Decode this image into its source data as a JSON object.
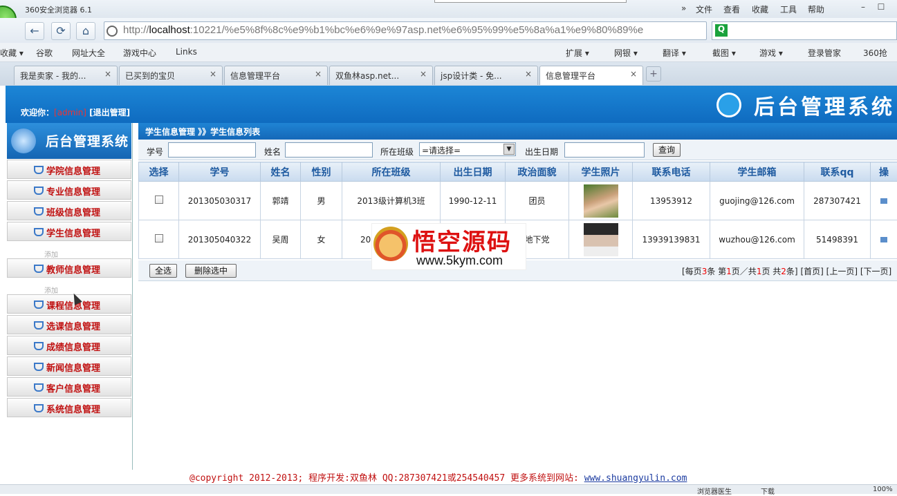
{
  "window": {
    "title": "360安全浏览器 6.1",
    "menu": [
      "文件",
      "查看",
      "收藏",
      "工具",
      "帮助"
    ],
    "min": "–",
    "max": "☐",
    "nav_chevron": "»"
  },
  "nav": {
    "back": "←",
    "refresh": "⟳",
    "home": "⌂",
    "url_prefix": "http://",
    "url_host": "localhost",
    "url_rest": ":10221/%e5%8f%8c%e9%b1%bc%e6%9e%97asp.net%e6%95%99%e5%8a%a1%e9%80%89%e",
    "search_icon": "Q"
  },
  "bookmarks": {
    "left": [
      "收藏 ▾",
      "谷歌",
      "网址大全",
      "游戏中心",
      "Links"
    ],
    "right": [
      "扩展 ▾",
      "网银 ▾",
      "翻译 ▾",
      "截图 ▾",
      "游戏 ▾",
      "登录管家",
      "360抢"
    ]
  },
  "tabs": [
    {
      "label": "我是卖家 - 我的..."
    },
    {
      "label": "已买到的宝贝"
    },
    {
      "label": "信息管理平台"
    },
    {
      "label": "双鱼林asp.net..."
    },
    {
      "label": "jsp设计类 - 免..."
    },
    {
      "label": "信息管理平台"
    }
  ],
  "tab_close": "×",
  "tab_new": "+",
  "header": {
    "welcome_prefix": "欢迎你：",
    "admin": "[admin]",
    "logout": "[退出管理]",
    "brand": "后台管理系统"
  },
  "sidebar": {
    "logo": "后台管理系统",
    "items": [
      "学院信息管理",
      "专业信息管理",
      "班级信息管理",
      "学生信息管理",
      "教师信息管理",
      "课程信息管理",
      "选课信息管理",
      "成绩信息管理",
      "新闻信息管理",
      "客户信息管理",
      "系统信息管理"
    ],
    "sub_add": "添加"
  },
  "breadcrumb": "学生信息管理 》》学生信息列表",
  "filter": {
    "id_label": "学号",
    "name_label": "姓名",
    "class_label": "所在班级",
    "class_value": "=请选择=",
    "birth_label": "出生日期",
    "query_button": "查询"
  },
  "table": {
    "headers": [
      "选择",
      "学号",
      "姓名",
      "性别",
      "所在班级",
      "出生日期",
      "政治面貌",
      "学生照片",
      "联系电话",
      "学生邮箱",
      "联系qq",
      "操"
    ],
    "rows": [
      {
        "id": "201305030317",
        "name": "郭靖",
        "sex": "男",
        "class": "2013级计算机3班",
        "birth": "1990-12-11",
        "politics": "团员",
        "phone": "13953912",
        "email": "guojing@126.com",
        "qq": "287307421"
      },
      {
        "id": "201305040322",
        "name": "吴周",
        "sex": "女",
        "class": "20",
        "birth": "",
        "politics": "地下党",
        "phone": "13939139831",
        "email": "wuzhou@126.com",
        "qq": "51498391"
      }
    ]
  },
  "actions": {
    "select_all": "全选",
    "delete_selected": "删除选中"
  },
  "pager": {
    "t1": "[每页",
    "per": "3",
    "t2": "条 第",
    "cur": "1",
    "t3": "页／共",
    "total_pages": "1",
    "t4": "页 共",
    "total": "2",
    "t5": "条]",
    "first": "[首页]",
    "prev": "[上一页]",
    "next": "[下一页]"
  },
  "footer": {
    "copyright": "@copyright 2012-2013; 程序开发:双鱼林  QQ:287307421或254540457  更多系统到网站: ",
    "site": "www.shuangyulin.com"
  },
  "watermark": {
    "cn": "悟空源码",
    "en": "www.5kym.com"
  },
  "status": {
    "left": "浏览器医生",
    "dl": "下载",
    "zoom": "100%"
  },
  "colors": {
    "header_blue": "#1c86d6",
    "accent_red": "#c01010",
    "head_text": "#1e5aa0"
  }
}
